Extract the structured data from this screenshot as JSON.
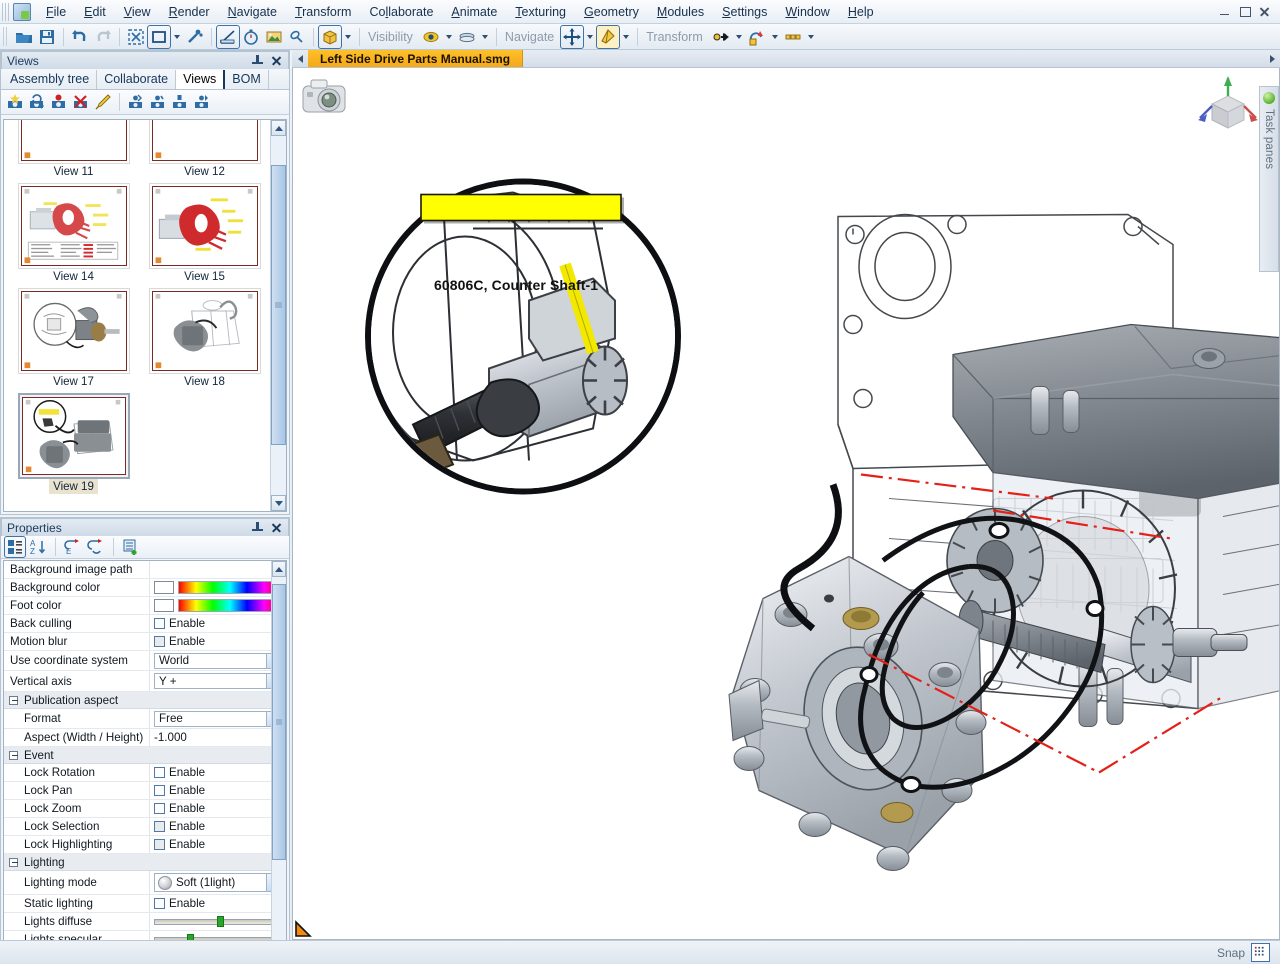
{
  "window": {
    "title": "Left Side Drive Parts Manual.smg",
    "controls": [
      {
        "name": "minimize",
        "glyph": "–"
      },
      {
        "name": "restore",
        "glyph": "❐"
      },
      {
        "name": "close",
        "glyph": "✕"
      }
    ]
  },
  "menubar": {
    "app_icon": "app-logo-icon",
    "items": [
      {
        "label": "File",
        "accel": "F"
      },
      {
        "label": "Edit",
        "accel": "E"
      },
      {
        "label": "View",
        "accel": "V"
      },
      {
        "label": "Render",
        "accel": "R"
      },
      {
        "label": "Navigate",
        "accel": "N"
      },
      {
        "label": "Transform",
        "accel": "T"
      },
      {
        "label": "Collaborate",
        "accel": "C"
      },
      {
        "label": "Animate",
        "accel": "A"
      },
      {
        "label": "Texturing",
        "accel": "T"
      },
      {
        "label": "Geometry",
        "accel": "G"
      },
      {
        "label": "Modules",
        "accel": "M"
      },
      {
        "label": "Settings",
        "accel": "S"
      },
      {
        "label": "Window",
        "accel": "W"
      },
      {
        "label": "Help",
        "accel": "H"
      }
    ]
  },
  "toolbar": {
    "groups": [
      {
        "name": "file",
        "buttons": [
          {
            "icon": "open-folder-icon",
            "label": "Open"
          },
          {
            "icon": "save-disk-icon",
            "label": "Save"
          }
        ]
      },
      {
        "name": "history",
        "buttons": [
          {
            "icon": "undo-arrow-icon",
            "label": "Undo"
          },
          {
            "icon": "redo-arrow-icon",
            "label": "Redo",
            "disabled": true
          }
        ]
      },
      {
        "name": "selection",
        "buttons": [
          {
            "icon": "select-all-icon",
            "label": "Select all"
          },
          {
            "icon": "rectangle-select-icon",
            "label": "Rectangle selection",
            "framed": true,
            "has_caret": true
          },
          {
            "icon": "magic-wand-icon",
            "label": "Smart selection"
          }
        ]
      },
      {
        "name": "measure",
        "buttons": [
          {
            "icon": "measure-ruler-icon",
            "label": "Measure",
            "framed": true
          },
          {
            "icon": "stopwatch-icon",
            "label": "Timer"
          },
          {
            "icon": "image-icon",
            "label": "Image"
          },
          {
            "icon": "link-icon",
            "label": "Link"
          }
        ]
      },
      {
        "name": "publish",
        "buttons": [
          {
            "icon": "publish-box-icon",
            "label": "Publish",
            "framed": true,
            "has_caret": true
          }
        ]
      }
    ],
    "visibility_label": "Visibility",
    "visibility_buttons": [
      {
        "icon": "eye-icon",
        "label": "Show/Hide",
        "has_caret": true
      },
      {
        "icon": "layers-icon",
        "label": "Layers",
        "has_caret": true
      }
    ],
    "navigate_label": "Navigate",
    "navigate_buttons": [
      {
        "icon": "pan-move-icon",
        "label": "Pan",
        "framed": true,
        "has_caret": true
      },
      {
        "icon": "fly-through-icon",
        "label": "Walk mode",
        "active": true,
        "has_caret": true
      }
    ],
    "transform_label": "Transform",
    "transform_buttons": [
      {
        "icon": "translate-icon",
        "label": "Translate",
        "has_caret": true
      },
      {
        "icon": "rotate-icon",
        "label": "Rotate",
        "has_caret": true
      },
      {
        "icon": "align-icon",
        "label": "Align",
        "has_caret": true
      }
    ]
  },
  "views_panel": {
    "title": "Views",
    "pin_icon": "pin-icon",
    "close_icon": "close-icon",
    "tabs": [
      {
        "label": "Assembly tree",
        "selected": false
      },
      {
        "label": "Collaborate",
        "selected": false
      },
      {
        "label": "Views",
        "selected": true
      },
      {
        "label": "BOM",
        "selected": false
      }
    ],
    "toolbar_buttons": [
      {
        "icon": "new-view-icon",
        "label": "Create view"
      },
      {
        "icon": "update-view-icon",
        "label": "Update view"
      },
      {
        "icon": "record-view-icon",
        "label": "Record view"
      },
      {
        "icon": "delete-view-icon",
        "label": "Delete view"
      },
      {
        "icon": "paint-brush-icon",
        "label": "Apply view style"
      },
      {
        "icon": "view-first-icon",
        "label": "First view"
      },
      {
        "icon": "view-prev-icon",
        "label": "Previous view"
      },
      {
        "icon": "view-next-icon",
        "label": "Next view"
      },
      {
        "icon": "view-last-icon",
        "label": "Last view"
      }
    ],
    "thumbnails": [
      {
        "label": "View 11",
        "selected": false,
        "kind": "blank"
      },
      {
        "label": "View 12",
        "selected": false,
        "kind": "exploded-red"
      },
      {
        "label": "View 14",
        "selected": false,
        "kind": "exploded-red-table"
      },
      {
        "label": "View 15",
        "selected": false,
        "kind": "exploded-red"
      },
      {
        "label": "View 17",
        "selected": false,
        "kind": "shaft-detail"
      },
      {
        "label": "View 18",
        "selected": false,
        "kind": "ghost-assembly"
      },
      {
        "label": "View 19",
        "selected": true,
        "kind": "callout-assembly"
      }
    ],
    "scrollbar": {
      "up_icon": "chevron-up-icon",
      "down_icon": "chevron-down-icon"
    }
  },
  "properties_panel": {
    "title": "Properties",
    "pin_icon": "pin-icon",
    "close_icon": "close-icon",
    "toolbar_buttons": [
      {
        "icon": "categorized-list-icon",
        "label": "Categorized",
        "active": true
      },
      {
        "icon": "sort-alpha-icon",
        "label": "Alphabetical"
      },
      {
        "icon": "reset-event-icon",
        "label": "Reset event"
      },
      {
        "icon": "refresh-event-icon",
        "label": "Refresh event"
      },
      {
        "icon": "add-property-icon",
        "label": "Add property"
      }
    ],
    "rows": [
      {
        "type": "prop",
        "name": "Background image path",
        "control": "text",
        "value": "",
        "warn": false
      },
      {
        "type": "prop",
        "name": "Background color",
        "control": "color",
        "value": "#ffffff",
        "warn": false
      },
      {
        "type": "prop",
        "name": "Foot color",
        "control": "color",
        "value": "#ffffff",
        "warn": false
      },
      {
        "type": "prop",
        "name": "Back culling",
        "control": "checkbox",
        "value": "Enable",
        "checked": false,
        "warn": true
      },
      {
        "type": "prop",
        "name": "Motion blur",
        "control": "checkbox",
        "value": "Enable",
        "checked": false,
        "dim": true,
        "warn": false
      },
      {
        "type": "prop",
        "name": "Use coordinate system",
        "control": "combo",
        "value": "World",
        "warn": false
      },
      {
        "type": "prop",
        "name": "Vertical axis",
        "control": "combo",
        "value": "Y +",
        "warn": true
      },
      {
        "type": "group",
        "name": "Publication aspect",
        "expanded": true
      },
      {
        "type": "prop",
        "name": "Format",
        "control": "combo",
        "value": "Free",
        "indent": true,
        "warn": false
      },
      {
        "type": "prop",
        "name": "Aspect (Width / Height)",
        "control": "text",
        "value": "-1.000",
        "indent": true,
        "warn": true
      },
      {
        "type": "group",
        "name": "Event",
        "expanded": true
      },
      {
        "type": "prop",
        "name": "Lock Rotation",
        "control": "checkbox",
        "value": "Enable",
        "checked": false,
        "indent": true,
        "warn": false
      },
      {
        "type": "prop",
        "name": "Lock Pan",
        "control": "checkbox",
        "value": "Enable",
        "checked": false,
        "indent": true,
        "warn": false
      },
      {
        "type": "prop",
        "name": "Lock Zoom",
        "control": "checkbox",
        "value": "Enable",
        "checked": false,
        "indent": true,
        "warn": false
      },
      {
        "type": "prop",
        "name": "Lock Selection",
        "control": "checkbox",
        "value": "Enable",
        "checked": false,
        "dim": true,
        "indent": true,
        "warn": false
      },
      {
        "type": "prop",
        "name": "Lock Highlighting",
        "control": "checkbox",
        "value": "Enable",
        "checked": false,
        "dim": true,
        "indent": true,
        "warn": false
      },
      {
        "type": "group",
        "name": "Lighting",
        "expanded": true
      },
      {
        "type": "prop",
        "name": "Lighting mode",
        "control": "combo-sphere",
        "value": "Soft (1light)",
        "indent": true,
        "warn": true
      },
      {
        "type": "prop",
        "name": "Static lighting",
        "control": "checkbox",
        "value": "Enable",
        "checked": false,
        "indent": true,
        "warn": true
      },
      {
        "type": "prop",
        "name": "Lights diffuse",
        "control": "slider",
        "value": "50",
        "indent": true,
        "warn": false
      },
      {
        "type": "prop",
        "name": "Lights specular",
        "control": "slider",
        "value": "26",
        "indent": true,
        "warn": false
      }
    ]
  },
  "viewport": {
    "doc_tab": "Left Side Drive Parts Manual.smg",
    "tab_scroll_left_icon": "chevron-left-icon",
    "tab_scroll_right_icon": "chevron-right-icon",
    "camera_icon": "camera-icon",
    "nav_cube_icon": "navigation-cube-icon",
    "corner_marker_icon": "orange-corner-triangle-icon",
    "callout_label": "60806C, Counter Shaft-1",
    "callout_bg": "#ffff00",
    "axis_colors": {
      "x": "#c94f4f",
      "y": "#3fae52",
      "z": "#4a5fc1"
    },
    "annotation_line_color": "#e32119"
  },
  "task_panes": {
    "label": "Task panes",
    "indicator_icon": "green-status-dot-icon"
  },
  "statusbar": {
    "snap_label": "Snap",
    "snap_icon": "snap-grid-icon"
  }
}
